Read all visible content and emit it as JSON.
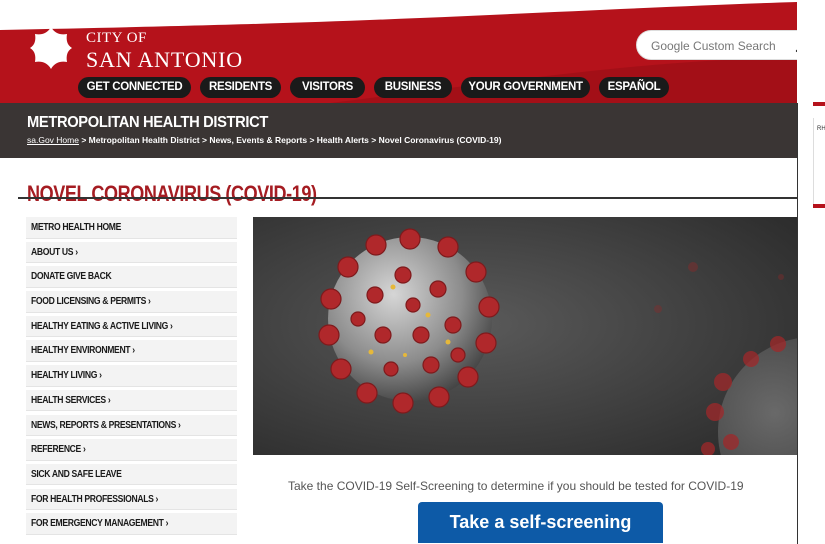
{
  "header": {
    "city_of": "CITY OF",
    "city_name": "SAN ANTONIO",
    "search": {
      "placeholder": "Google Custom Search"
    },
    "nav": [
      "GET CONNECTED",
      "RESIDENTS",
      "VISITORS",
      "BUSINESS",
      "YOUR GOVERNMENT",
      "ESPAÑOL"
    ]
  },
  "district": {
    "title": "METROPOLITAN HEALTH DISTRICT",
    "breadcrumb": {
      "home": "sa.Gov Home",
      "rest": " > Metropolitan Health District > News, Events & Reports > Health Alerts > Novel Coronavirus (COVID-19)"
    }
  },
  "page_title": "NOVEL CORONAVIRUS (COVID-19)",
  "sidebar": {
    "items": [
      "METRO HEALTH HOME",
      "ABOUT US ›",
      "DONATE GIVE BACK",
      "FOOD LICENSING & PERMITS ›",
      "HEALTHY EATING & ACTIVE LIVING ›",
      "HEALTHY ENVIRONMENT ›",
      "HEALTHY LIVING ›",
      "HEALTH SERVICES ›",
      "NEWS, REPORTS & PRESENTATIONS ›",
      "REFERENCE ›",
      "SICK AND SAFE LEAVE",
      "FOR HEALTH PROFESSIONALS ›",
      "FOR EMERGENCY MANAGEMENT ›"
    ]
  },
  "main": {
    "screening_text": "Take the COVID-19 Self-Screening to determine if you should be tested for COVID-19",
    "screening_button": "Take a self-screening"
  },
  "right_panel": {
    "label": "RH"
  },
  "colors": {
    "brand_red": "#b5121b",
    "dark_bar": "#3a3534",
    "title_red": "#a51c22",
    "button_blue": "#0d5aa7"
  }
}
